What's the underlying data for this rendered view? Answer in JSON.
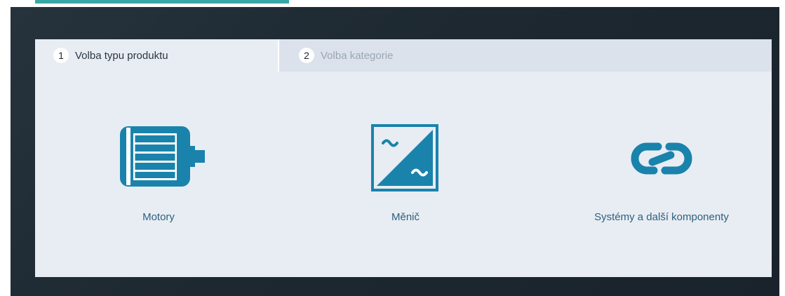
{
  "tabs": [
    {
      "number": "1",
      "label": "Volba typu produktu",
      "active": true
    },
    {
      "number": "2",
      "label": "Volba kategorie",
      "active": false
    }
  ],
  "categories": [
    {
      "label": "Motory",
      "icon": "motor-icon"
    },
    {
      "label": "Měnič",
      "icon": "converter-icon"
    },
    {
      "label": "Systémy a další komponenty",
      "icon": "link-icon"
    }
  ],
  "colors": {
    "accent": "#3aa6a6",
    "icon": "#1a83ac",
    "label": "#2d5f7f",
    "panel": "#e8edf3",
    "frame": "#1d2830"
  }
}
